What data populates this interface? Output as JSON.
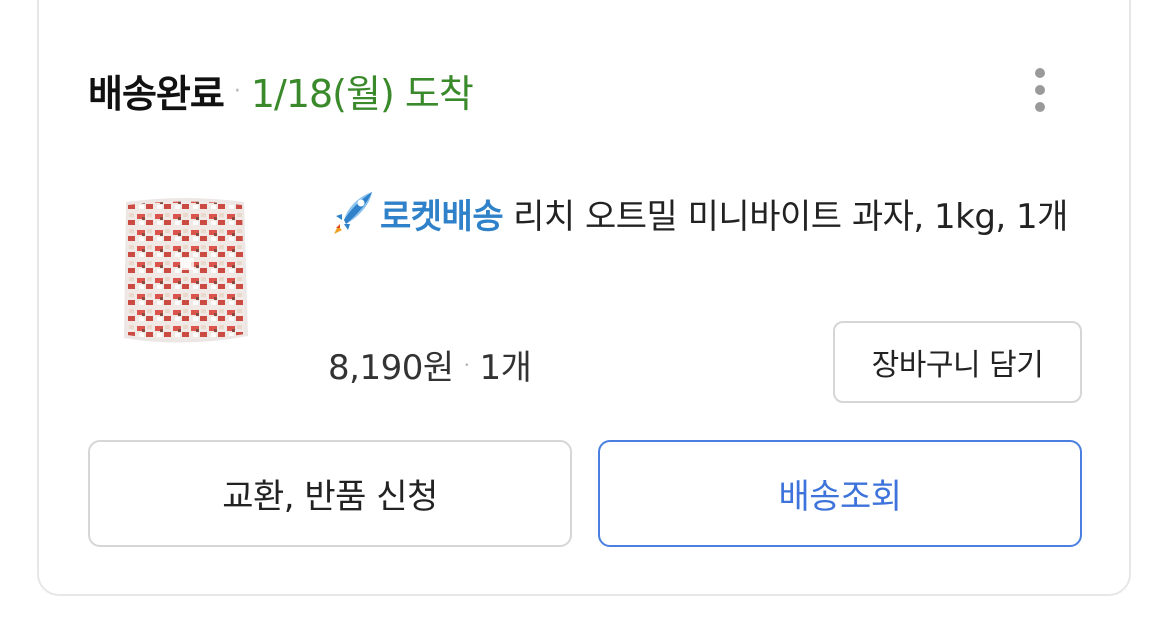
{
  "order": {
    "status": "배송완료",
    "separator": "·",
    "arrival": "1/18(월) 도착",
    "more_icon": "more-vertical-icon"
  },
  "product": {
    "delivery_badge": "로켓배송",
    "delivery_icon": "rocket-icon",
    "name": "리치 오트밀 미니바이트 과자, 1kg, 1개",
    "price": "8,190원",
    "quantity": "1개",
    "add_to_cart_label": "장바구니 담기"
  },
  "actions": {
    "return_label": "교환, 반품 신청",
    "track_label": "배송조회"
  },
  "colors": {
    "arrival_green": "#3a8a2c",
    "rocket_blue": "#2f82c9",
    "track_blue": "#3d73db"
  }
}
